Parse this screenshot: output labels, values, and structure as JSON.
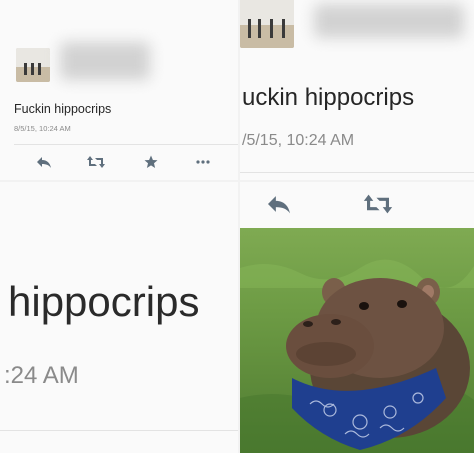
{
  "panels": {
    "top_left": {
      "tweet_text": "Fuckin hippocrips",
      "timestamp": "8/5/15, 10:24 AM",
      "actions": [
        "reply-icon",
        "retweet-icon",
        "favorite-icon",
        "more-icon"
      ]
    },
    "top_right": {
      "tweet_text": "uckin hippocrips",
      "timestamp": "/5/15, 10:24 AM",
      "actions": [
        "reply-icon",
        "retweet-icon"
      ]
    },
    "bottom_left": {
      "tweet_text": "hippocrips",
      "timestamp": ":24 AM"
    },
    "bottom_right": {
      "image": "hippo-wearing-blue-bandana"
    }
  },
  "colors": {
    "icon_gray": "#5f6f7d",
    "timestamp_gray": "#8a8a8a",
    "bandana_blue": "#1f3f8f",
    "grass_green": "#6e9c45"
  }
}
